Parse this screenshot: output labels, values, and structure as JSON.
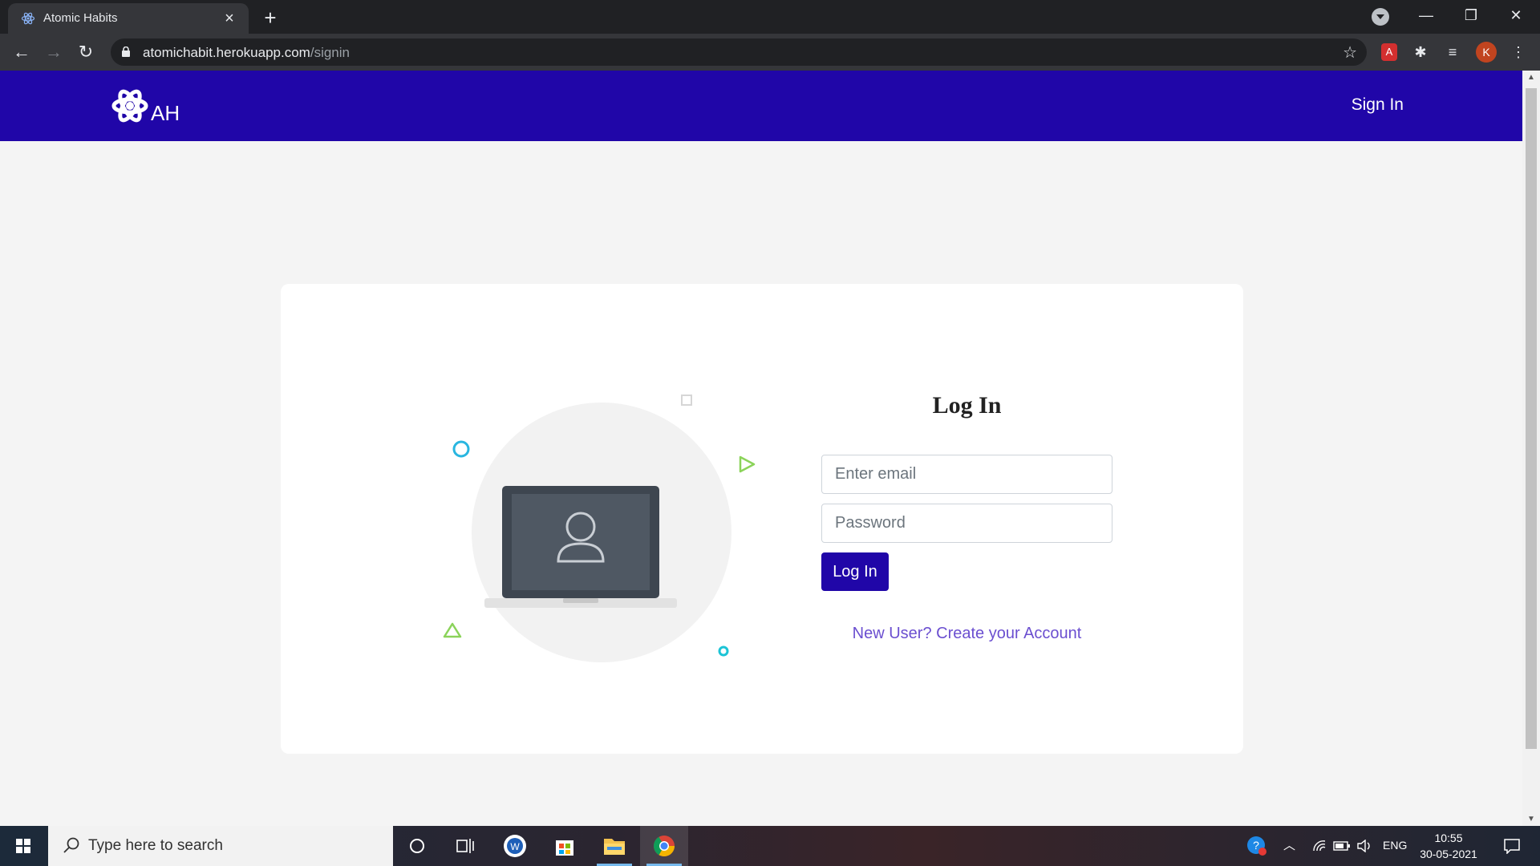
{
  "browser": {
    "tab_title": "Atomic Habits",
    "new_tab": "+",
    "url_host": "atomichabit.herokuapp.com",
    "url_path": "/signin",
    "profile_initial": "K"
  },
  "site": {
    "brand_text": "AH",
    "nav_signin": "Sign In"
  },
  "login": {
    "title": "Log In",
    "email_placeholder": "Enter email",
    "password_placeholder": "Password",
    "submit_label": "Log In",
    "signup_link": "New User? Create your Account"
  },
  "taskbar": {
    "search_placeholder": "Type here to search",
    "language": "ENG",
    "time": "10:55",
    "date": "30-05-2021"
  },
  "colors": {
    "brand": "#2006a8",
    "link": "#6b4fd0",
    "accent_cyan": "#29b6e0",
    "accent_green": "#8bd35a"
  }
}
